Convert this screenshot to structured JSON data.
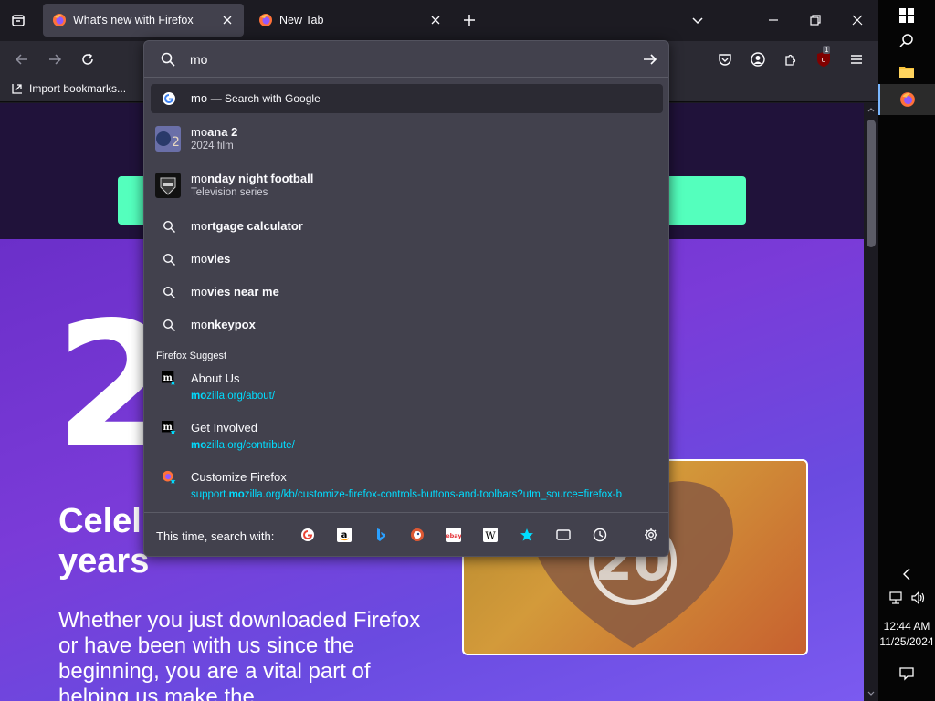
{
  "tabs": [
    {
      "title": "What's new with Firefox",
      "active": true
    },
    {
      "title": "New Tab",
      "active": false
    }
  ],
  "bookmarks": {
    "import_label": "Import bookmarks..."
  },
  "urlbar": {
    "query": "mo",
    "google_row": {
      "typed": "mo",
      "suffix": "— Search with Google"
    },
    "suggestions": [
      {
        "typed": "mo",
        "rest": "ana 2",
        "sub": "2024 film",
        "kind": "image"
      },
      {
        "typed": "mo",
        "rest": "nday night football",
        "sub": "Television series",
        "kind": "image"
      },
      {
        "typed": "mo",
        "rest": "rtgage calculator",
        "kind": "search"
      },
      {
        "typed": "mo",
        "rest": "vies",
        "kind": "search"
      },
      {
        "typed": "mo",
        "rest": "vies near me",
        "kind": "search"
      },
      {
        "typed": "mo",
        "rest": "nkeypox",
        "kind": "search"
      }
    ],
    "section_label": "Firefox Suggest",
    "suggest": [
      {
        "title": "About Us",
        "url_bold": "mo",
        "url_rest": "zilla.org/about/"
      },
      {
        "title": "Get Involved",
        "url_bold": "mo",
        "url_rest": "zilla.org/contribute/"
      },
      {
        "title": "Customize Firefox",
        "url_pre": "support.",
        "url_bold": "mo",
        "url_rest": "zilla.org/kb/customize-firefox-controls-buttons-and-toolbars?utm_source=firefox-b"
      }
    ],
    "search_with_label": "This time, search with:"
  },
  "page": {
    "big_number": "2",
    "headline_line1": "Celel",
    "headline_line2": "years",
    "paragraph": "Whether you just downloaded Firefox or have been with us since the beginning, you are a vital part of helping us make the"
  },
  "taskbar": {
    "time": "12:44 AM",
    "date": "11/25/2024"
  },
  "extension_badge": "1",
  "colors": {
    "accent_url": "#00ddff",
    "dropdown_bg": "#42414d",
    "page_gradient": "#7a3bd8",
    "green_bar": "#54ffbd"
  }
}
